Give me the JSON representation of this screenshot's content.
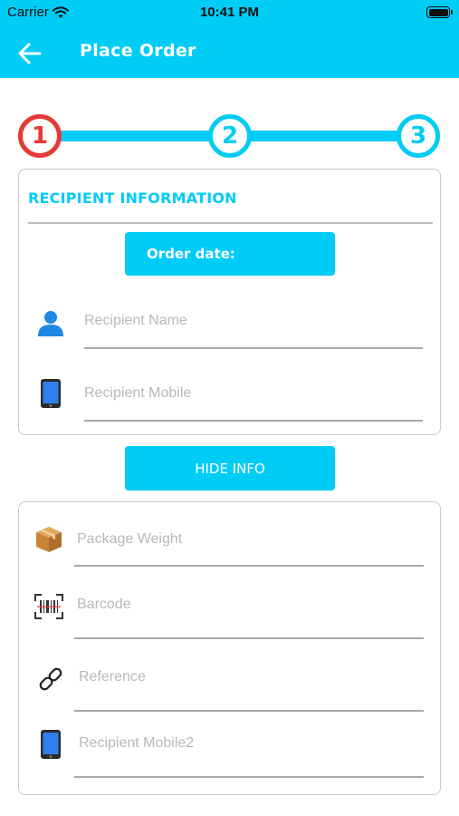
{
  "status_bar": {
    "carrier": "Carrier",
    "time": "10:41 PM"
  },
  "header": {
    "title": "Place Order",
    "icon": "arrow-left-icon"
  },
  "stepper": {
    "steps": [
      "1",
      "2",
      "3"
    ],
    "active_step": 1
  },
  "recipient_section": {
    "title": "RECIPIENT INFORMATION",
    "order_date_label": "Order date:",
    "fields": [
      {
        "placeholder": "Recipient Name",
        "icon": "person-icon"
      },
      {
        "placeholder": "Recipient Mobile",
        "icon": "mobile-phone-icon"
      }
    ]
  },
  "hide_info_button": "HIDE INFO",
  "package_section": {
    "fields": [
      {
        "placeholder": "Package Weight",
        "icon": "package-box-icon"
      },
      {
        "placeholder": "Barcode",
        "icon": "barcode-scanner-icon"
      },
      {
        "placeholder": "Reference",
        "icon": "link-icon"
      },
      {
        "placeholder": "Recipient Mobile2",
        "icon": "mobile-phone-icon"
      }
    ]
  },
  "colors": {
    "primary": "#00CCF5",
    "active_step": "#E53935"
  }
}
